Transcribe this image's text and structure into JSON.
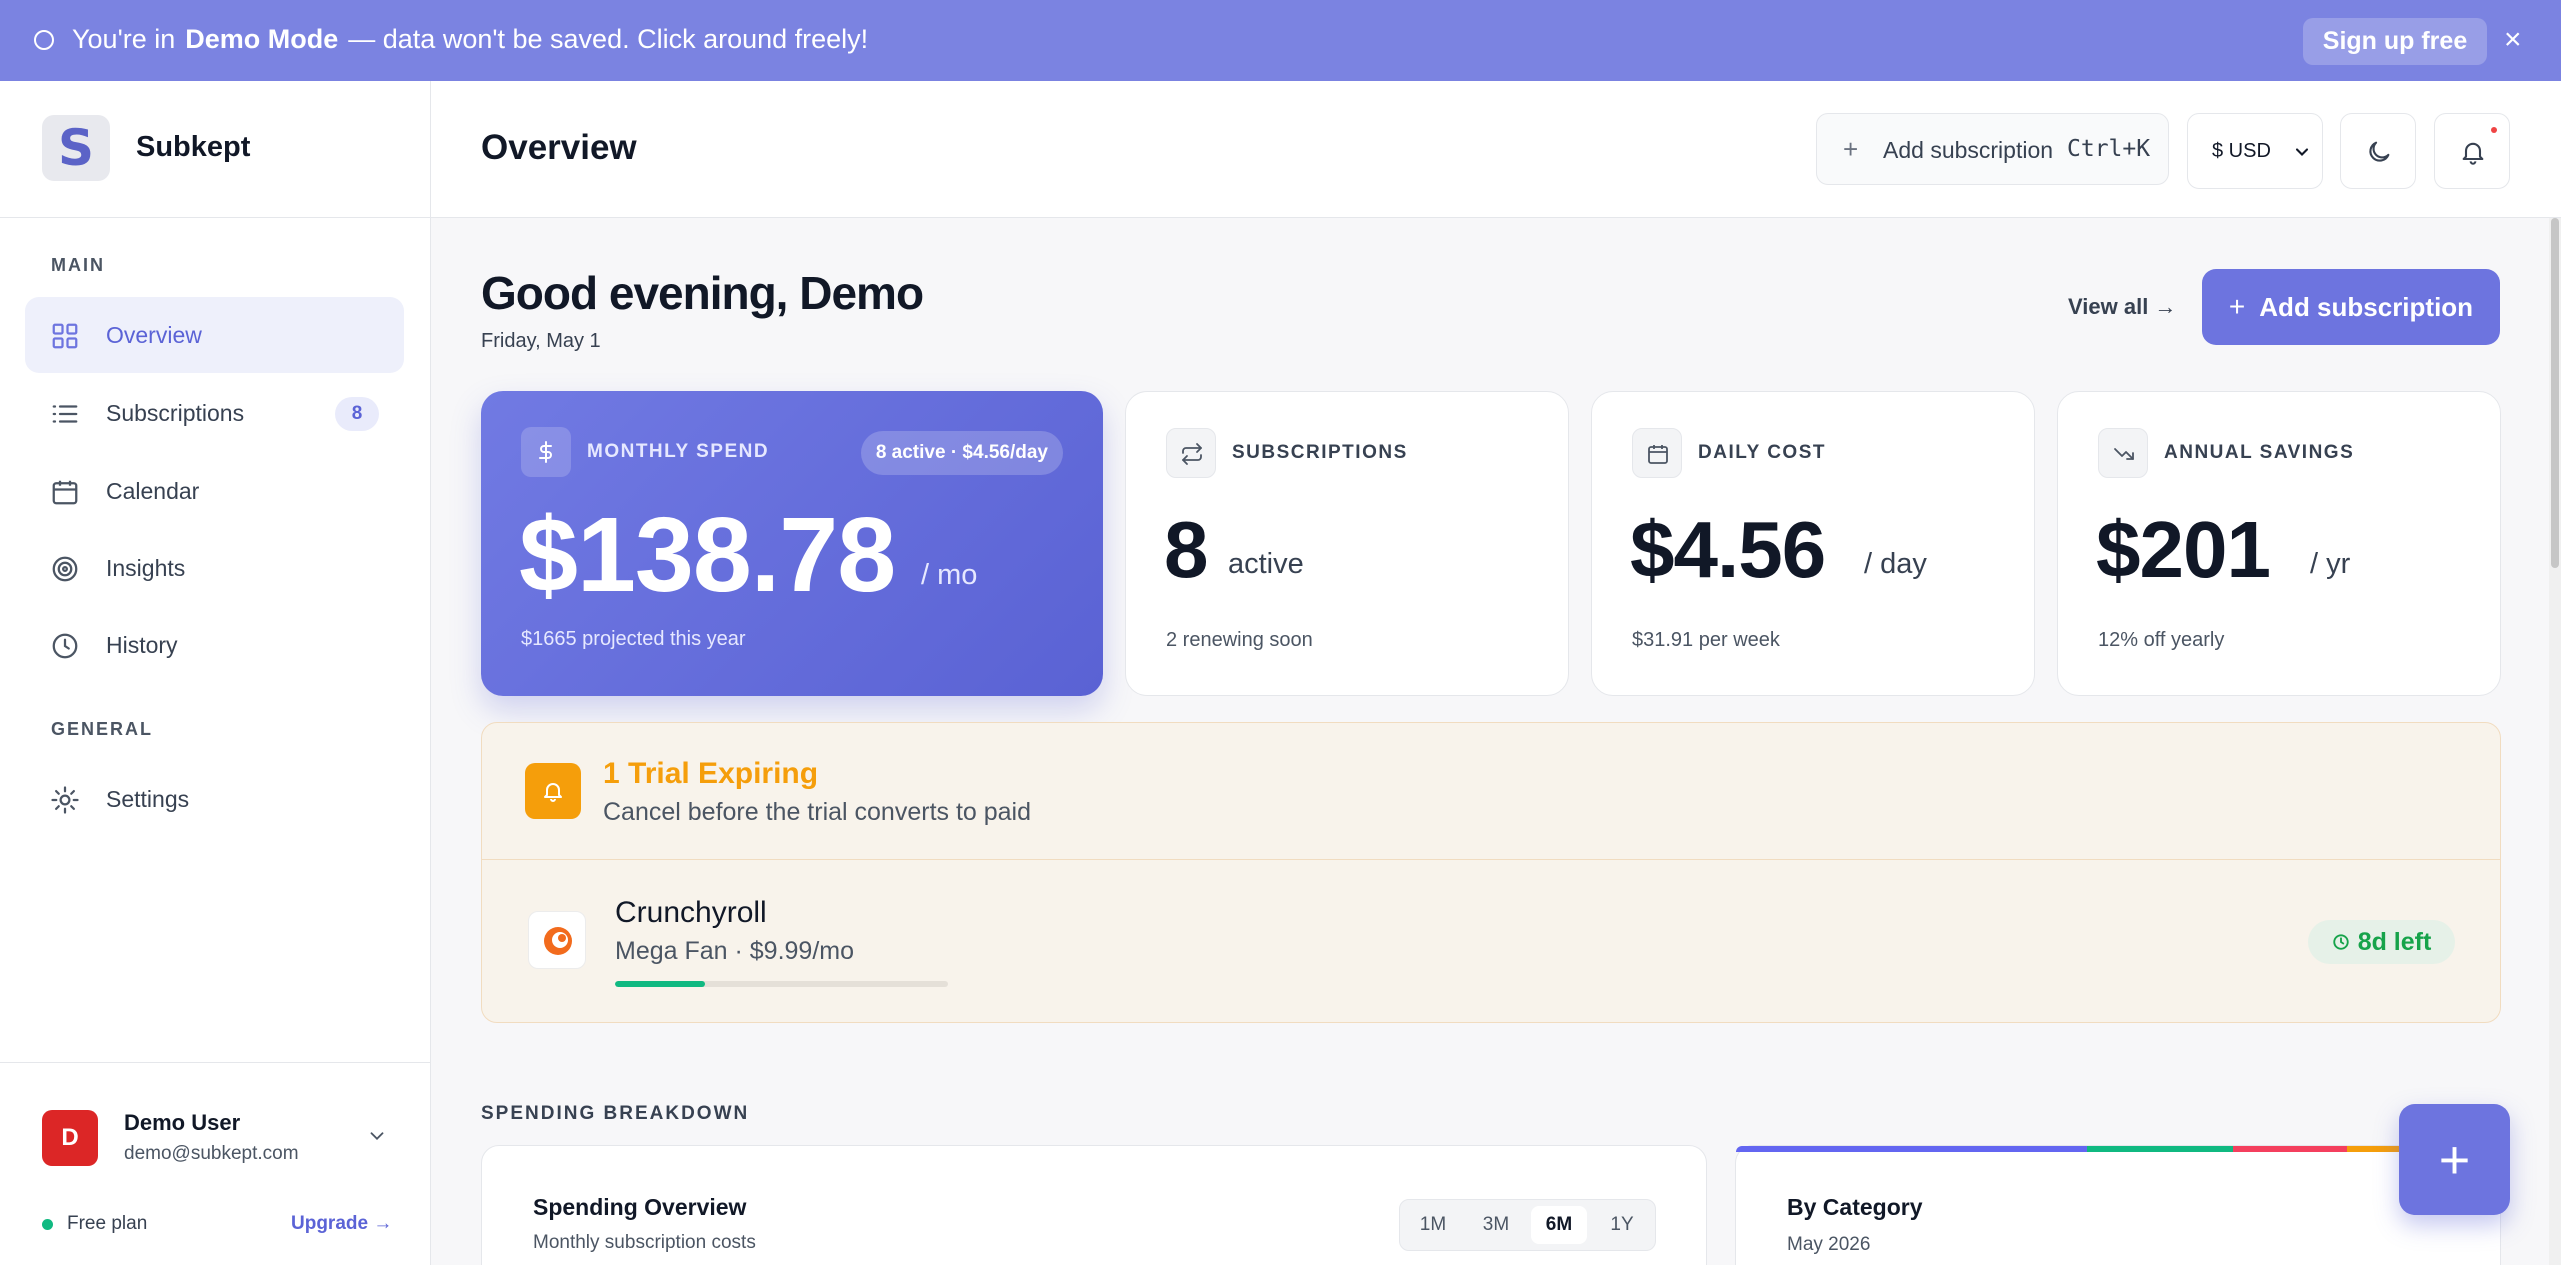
{
  "banner": {
    "prefix": "You're in",
    "mode": "Demo Mode",
    "suffix": "— data won't be saved. Click around freely!",
    "signup_label": "Sign up free",
    "close_glyph": "×"
  },
  "sidebar": {
    "logo_letter": "S",
    "app_name": "Subkept",
    "main_label": "MAIN",
    "general_label": "GENERAL",
    "items": [
      {
        "label": "Overview",
        "icon": "grid-icon",
        "active": true
      },
      {
        "label": "Subscriptions",
        "icon": "list-icon",
        "badge": "8"
      },
      {
        "label": "Calendar",
        "icon": "calendar-icon"
      },
      {
        "label": "Insights",
        "icon": "target-icon"
      },
      {
        "label": "History",
        "icon": "clock-icon"
      },
      {
        "label": "Settings",
        "icon": "gear-icon"
      }
    ],
    "user": {
      "initial": "D",
      "name": "Demo User",
      "email": "demo@subkept.com"
    },
    "plan": "Free plan",
    "upgrade": "Upgrade →"
  },
  "header": {
    "title": "Overview",
    "add_label": "Add subscription",
    "shortcut": "Ctrl+K",
    "currency": "$ USD"
  },
  "main": {
    "greeting": "Good evening, Demo",
    "date": "Friday, May 1",
    "view_all": "View all →",
    "add_button": "Add subscription",
    "cards": [
      {
        "label": "MONTHLY SPEND",
        "pill": "8 active · $4.56/day",
        "value": "$138.78",
        "unit": "/ mo",
        "foot": "$1665 projected this year"
      },
      {
        "label": "SUBSCRIPTIONS",
        "value": "8",
        "unit": "active",
        "foot": "2 renewing soon"
      },
      {
        "label": "DAILY COST",
        "value": "$4.56",
        "unit": "/ day",
        "foot": "$31.91 per week"
      },
      {
        "label": "ANNUAL SAVINGS",
        "value": "$201",
        "unit": "/ yr",
        "foot": "12% off yearly"
      }
    ],
    "trial": {
      "title": "1 Trial Expiring",
      "subtitle": "Cancel before the trial converts to paid",
      "service": "Crunchyroll",
      "plan": "Mega Fan · $9.99/mo",
      "progress": 0.27,
      "days_left": "8d left"
    },
    "breakdown_label": "SPENDING BREAKDOWN",
    "spending": {
      "title": "Spending Overview",
      "subtitle": "Monthly subscription costs",
      "ranges": [
        "1M",
        "3M",
        "6M",
        "1Y"
      ],
      "selected_range": "6M"
    },
    "category": {
      "title": "By Category",
      "subtitle": "May 2026",
      "bar_colors": [
        "#6366f1",
        "#10b981",
        "#f43f5e",
        "#f59e0b",
        "#3b82f6"
      ],
      "bar_shares": [
        0.46,
        0.19,
        0.15,
        0.1,
        0.1
      ]
    }
  },
  "fab": {
    "glyph": "+"
  }
}
